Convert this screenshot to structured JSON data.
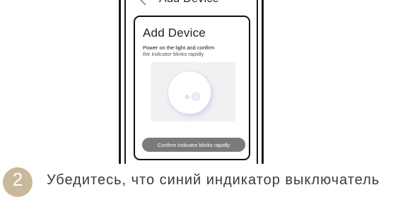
{
  "app": {
    "top_title": "Add Device"
  },
  "card": {
    "title": "Add Device",
    "line1": "Power on the light and confirm",
    "line2": "the indicator blinks rapidly",
    "button_label": "Confirm indicator blinks rapidly"
  },
  "step": {
    "number": "2",
    "text": "Убедитесь, что синий индикатор выключатель"
  },
  "colors": {
    "button_bg": "#7a7a7a",
    "badge_bg": "#c9b89a",
    "frame": "#1a1a1a"
  }
}
